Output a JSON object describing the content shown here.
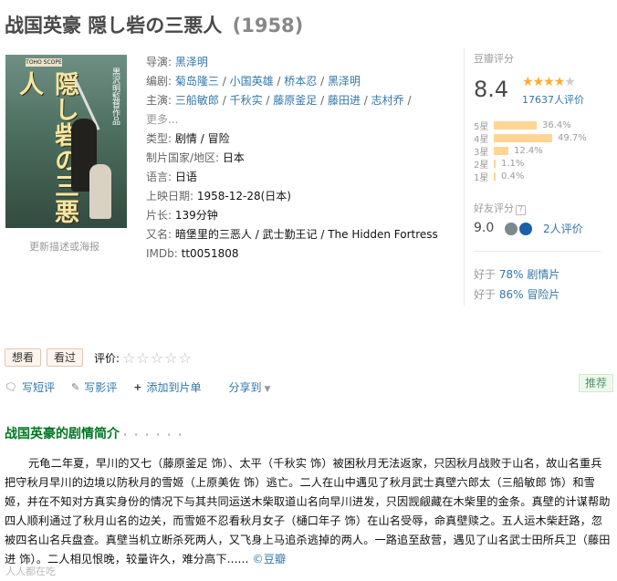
{
  "title": {
    "main": "战国英豪 隠し砦の三悪人",
    "year": "(1958)"
  },
  "poster": {
    "vertical_title": "隠し砦の三悪人",
    "credit": "黒沢明監督作品",
    "badge": "TOHO SCOPE",
    "update_link": "更新描述或海报"
  },
  "info": {
    "director_label": "导演:",
    "directors": [
      "黑泽明"
    ],
    "writer_label": "编剧:",
    "writers": [
      "菊岛隆三",
      "小国英雄",
      "桥本忍",
      "黑泽明"
    ],
    "cast_label": "主演:",
    "cast": [
      "三船敏郎",
      "千秋实",
      "藤原釜足",
      "藤田进",
      "志村乔"
    ],
    "cast_more": "更多...",
    "genre_label": "类型:",
    "genres": [
      "剧情",
      "冒险"
    ],
    "country_label": "制片国家/地区:",
    "country": "日本",
    "language_label": "语言:",
    "language": "日语",
    "release_label": "上映日期:",
    "release": "1958-12-28(日本)",
    "runtime_label": "片长:",
    "runtime": "139分钟",
    "aka_label": "又名:",
    "aka": "暗堡里的三恶人 / 武士勤王记 / The Hidden Fortress",
    "imdb_label": "IMDb:",
    "imdb": "tt0051808",
    "separator": " / "
  },
  "rating": {
    "label": "豆瓣评分",
    "score": "8.4",
    "stars_filled": 4,
    "stars_total": 5,
    "votes": "17637人评价",
    "distribution": [
      {
        "label": "5星",
        "pct": "36.4%",
        "value": 36.4
      },
      {
        "label": "4星",
        "pct": "49.7%",
        "value": 49.7
      },
      {
        "label": "3星",
        "pct": "12.4%",
        "value": 12.4
      },
      {
        "label": "2星",
        "pct": "1.1%",
        "value": 1.1
      },
      {
        "label": "1星",
        "pct": "0.4%",
        "value": 0.4
      }
    ],
    "friend_label": "好友评分",
    "friend_q": "?",
    "friend_score": "9.0",
    "friend_count": "2人评价",
    "better1_prefix": "好于",
    "better1_pct": "78%",
    "better1_genre": "剧情片",
    "better2_prefix": "好于",
    "better2_pct": "86%",
    "better2_genre": "冒险片"
  },
  "actions": {
    "want": "想看",
    "seen": "看过",
    "rate_label": "评价:",
    "rate_stars": "☆☆☆☆☆"
  },
  "tools": {
    "short_review": "写短评",
    "review": "写影评",
    "add_list": "添加到片单",
    "share": "分享到",
    "recommend": "推荐"
  },
  "summary": {
    "title": "战国英豪的剧情简介",
    "dots": "· · · · · ·",
    "text": "元龟二年夏，早川的又七（藤原釜足 饰）、太平（千秋实 饰）被困秋月无法返家，只因秋月战败于山名，故山名重兵把守秋月早川的边境以防秋月的雪姬（上原美佐 饰）逃亡。二人在山中遇见了秋月武士真壁六郎太（三船敏郎 饰）和雪姬，并在不知对方真实身份的情况下与其共同运送木柴取道山名向早川进发，只因觊觎藏在木柴里的金条。真壁的计谋帮助四人顺利通过了秋月山名的边关，而雪姬不忍看秋月女子（樋口年子 饰）在山名受辱，命真壁赎之。五人运木柴赶路，忽被四名山名兵盘查。真壁当机立断杀死两人，又飞身上马追杀逃掉的两人。一路追至敌营，遇见了山名武士田所兵卫（藤田进 饰）。二人相见恨晚，较量许久，难分高下......",
    "source": "©豆瓣"
  },
  "watermark": "人人都在吃"
}
